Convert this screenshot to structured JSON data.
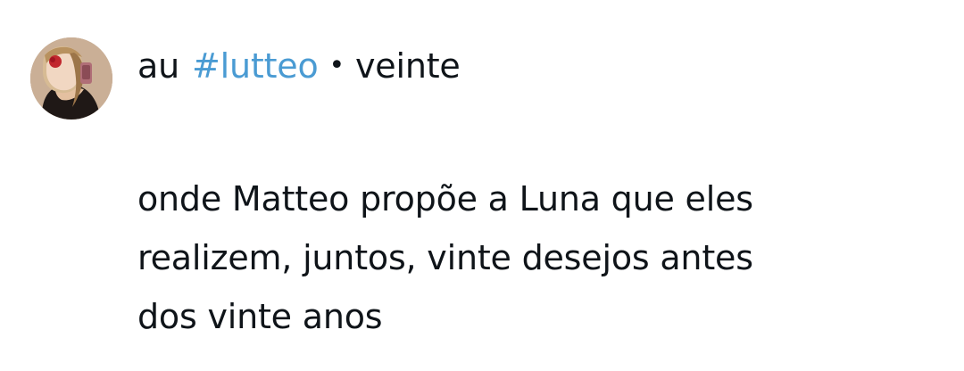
{
  "post": {
    "prefix": "au",
    "hashtag": "#lutteo",
    "separator": "•",
    "suffix": "veinte",
    "body_lines": [
      "onde Matteo propõe a Luna que eles",
      "realizem, juntos, vinte desejos antes",
      "dos vinte anos"
    ]
  },
  "colors": {
    "text": "#0f1419",
    "hashtag": "#4a9bd3",
    "background": "#ffffff"
  },
  "icons": {
    "avatar": "profile-avatar"
  }
}
